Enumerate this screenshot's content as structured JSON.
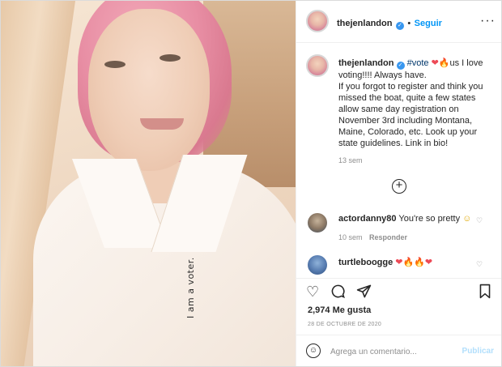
{
  "post": {
    "overlay_text": "I am a voter."
  },
  "header": {
    "username": "thejenlandon",
    "separator": "•",
    "follow_label": "Seguir",
    "more_icon": "more-horizontal-icon"
  },
  "caption": {
    "username": "thejenlandon",
    "hashtag": "#vote",
    "after_emoji": "us I love voting!!!! Always have.",
    "body": "If you forgot to register and think you missed the boat, quite a few states allow same day registration on November 3rd including Montana, Maine, Colorado, etc. Look up your state guidelines. Link in bio!",
    "time": "13 sem"
  },
  "load_more_icon": "plus-circle-icon",
  "comments": [
    {
      "username": "actordanny80",
      "text": "You're so pretty",
      "emoji": "☺",
      "time": "10 sem",
      "reply_label": "Responder"
    },
    {
      "username": "turtleboogge",
      "emoji": "❤🔥🔥❤"
    }
  ],
  "actions": {
    "like_icon": "heart-icon",
    "comment_icon": "comment-icon",
    "share_icon": "paper-plane-icon",
    "save_icon": "bookmark-icon",
    "likes_count": "2,974",
    "likes_label": "Me gusta",
    "date": "28 DE OCTUBRE DE 2020"
  },
  "add_comment": {
    "emoji_icon": "smiley-icon",
    "placeholder": "Agrega un comentario...",
    "publish_label": "Publicar"
  },
  "colors": {
    "link_blue": "#0095f6",
    "verified_blue": "#3897f0",
    "publish_disabled": "#b2dffc",
    "muted_text": "#8e8e8e"
  }
}
